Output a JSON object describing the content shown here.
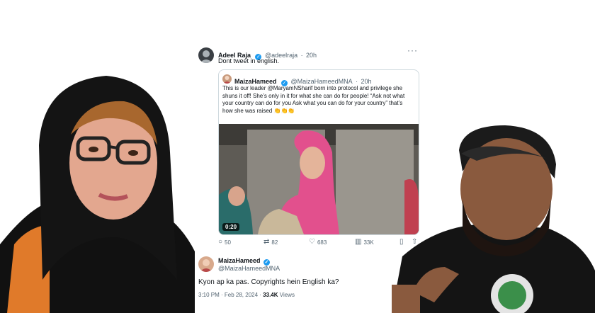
{
  "quote_tweet": {
    "author_name": "Adeel Raja",
    "author_handle": "@adeelraja",
    "time": "20h",
    "text": "Dont tweet in english.",
    "more": "···"
  },
  "quoted_tweet": {
    "author_name": "MaizaHameed",
    "author_handle": "@MaizaHameedMNA",
    "time": "20h",
    "text": "This is our leader @MaryamNSharif born into protocol and privilege she shuns it off! She’s only in it for what she can do for people! “Ask not what your country can do for you Ask what you can do for your country” that’s how she was raised",
    "emoji": "👏👏👏",
    "video_duration": "0:20"
  },
  "actions": {
    "replies": "50",
    "retweets": "82",
    "likes": "683",
    "views": "33K"
  },
  "reply_tweet": {
    "author_name": "MaizaHameed",
    "author_handle": "@MaizaHameedMNA",
    "text": "Kyon ap ka pas. Copyrights hein English ka?",
    "timestamp": "3:10 PM · Feb 28, 2024 ·",
    "views_count": "33.4K",
    "views_label": "Views"
  },
  "colors": {
    "accent": "#1d9bf0",
    "muted": "#536471"
  }
}
